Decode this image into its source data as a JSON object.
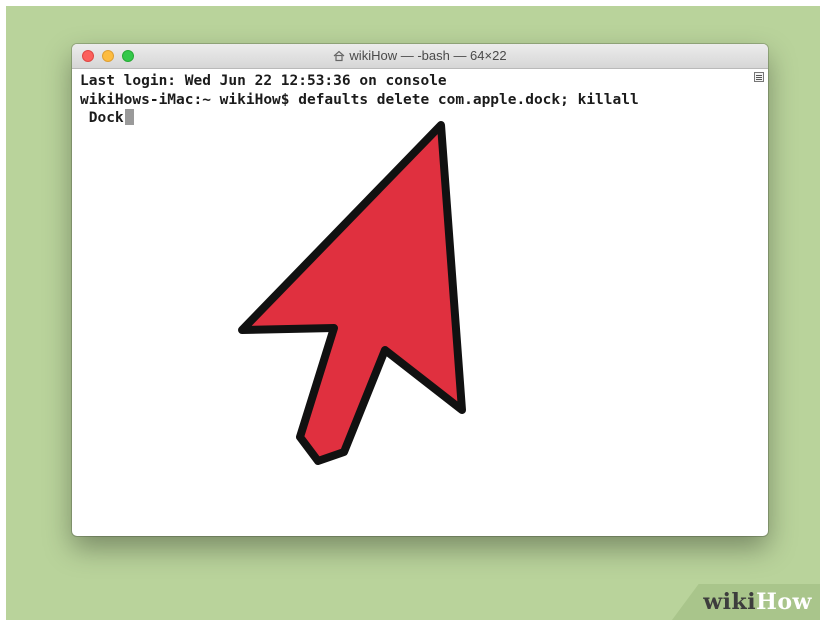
{
  "window": {
    "title": "wikiHow — -bash — 64×22"
  },
  "terminal": {
    "lines": [
      "Last login: Wed Jun 22 12:53:36 on console",
      "wikiHows-iMac:~ wikiHow$ defaults delete com.apple.dock; killall",
      " Dock"
    ]
  },
  "overlay": {
    "arrow_color": "#e0303f",
    "arrow_outline": "#111111"
  },
  "watermark": {
    "part1": "wiki",
    "part2": "How"
  },
  "colors": {
    "background": "#b9d39b",
    "close": "#fc605c",
    "minimize": "#fdbc40",
    "maximize": "#34c84a"
  }
}
